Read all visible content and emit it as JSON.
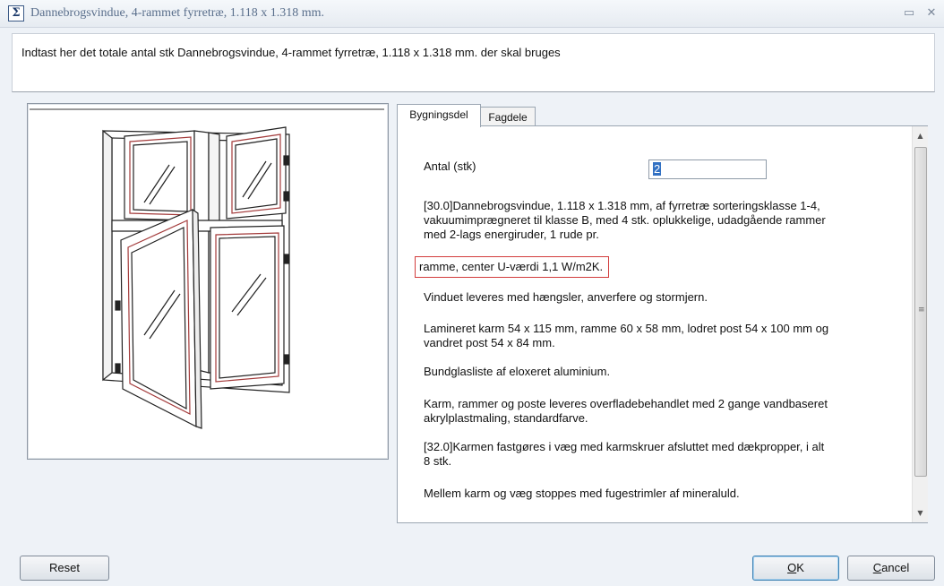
{
  "window": {
    "title": "Dannebrogsvindue, 4-rammet fyrretræ, 1.118 x 1.318 mm.",
    "icon": "sigma-icon",
    "minimize_glyph": "▭",
    "close_glyph": "✕"
  },
  "instruction": "Indtast her det totale antal stk Dannebrogsvindue, 4-rammet fyrretræ, 1.118 x 1.318 mm. der skal bruges",
  "tabs": [
    {
      "label": "Bygningsdel",
      "active": true
    },
    {
      "label": "Fagdele",
      "active": false
    }
  ],
  "form": {
    "antal_label": "Antal (stk)",
    "antal_value": "2"
  },
  "description": {
    "p1": "[30.0]Dannebrogsvindue, 1.118 x 1.318 mm, af fyrretræ sorteringsklasse 1-4,\nvakuumimprægneret til klasse B, med 4 stk. oplukkelige, udadgående rammer\nmed 2-lags energiruder, 1 rude pr.",
    "p2": "ramme, center U-værdi 1,1 W/m2K.",
    "p3": "Vinduet leveres med hængsler, anverfere og stormjern.",
    "p4": "Lamineret karm 54 x 115 mm, ramme 60 x 58 mm, lodret post 54 x 100 mm og\nvandret post 54 x 84 mm.",
    "p5": "Bundglasliste af eloxeret aluminium.",
    "p6": "Karm, rammer og poste leveres overfladebehandlet med 2 gange vandbaseret\nakrylplastmaling, standardfarve.",
    "p7": "[32.0]Karmen fastgøres i væg med karmskruer afsluttet med dækpropper, i alt\n8 stk.",
    "p8": "Mellem karm og væg stoppes med fugestrimler af mineraluld."
  },
  "scrollbar": {
    "up_glyph": "▲",
    "down_glyph": "▼",
    "grip_glyph": "≡"
  },
  "buttons": {
    "reset": "Reset",
    "ok_mnemonic": "O",
    "ok_rest": "K",
    "cancel_mnemonic": "C",
    "cancel_rest": "ancel"
  },
  "colors": {
    "highlight_box": "#d23c3c",
    "selection": "#3271c3",
    "window_frame": "#a33a3a"
  }
}
